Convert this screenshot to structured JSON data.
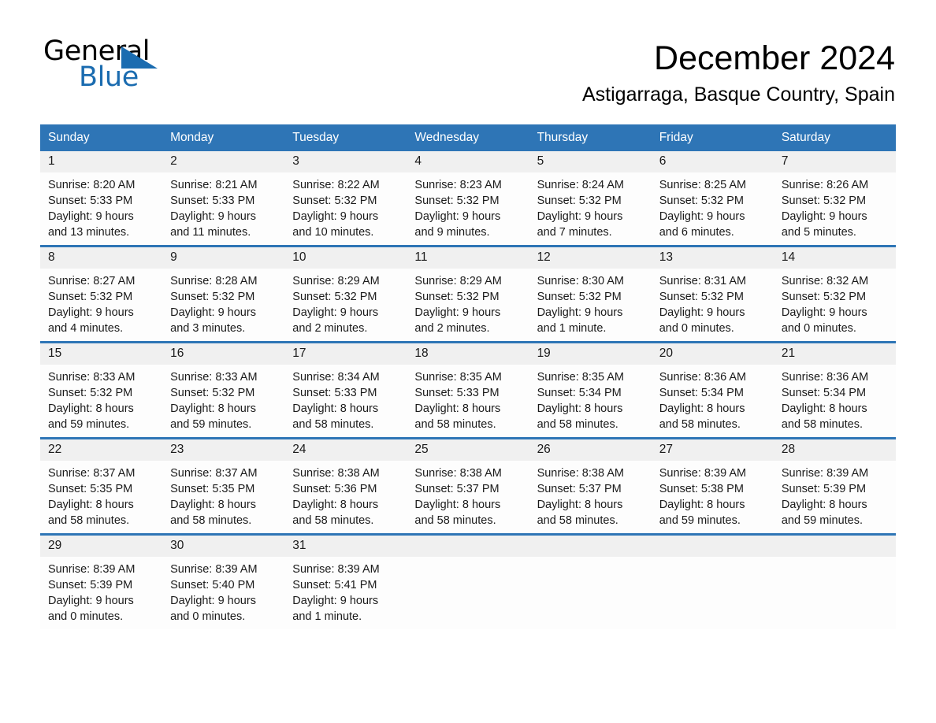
{
  "logo": {
    "word_one": "General",
    "word_two": "Blue",
    "accent_color": "#1b6cb0"
  },
  "header": {
    "month_title": "December 2024",
    "location": "Astigarraga, Basque Country, Spain"
  },
  "calendar": {
    "header_color": "#2e75b6",
    "daynum_band_color": "#f0f0f0",
    "weekday_headers": [
      "Sunday",
      "Monday",
      "Tuesday",
      "Wednesday",
      "Thursday",
      "Friday",
      "Saturday"
    ],
    "weeks": [
      [
        {
          "day": "1",
          "sunrise": "Sunrise: 8:20 AM",
          "sunset": "Sunset: 5:33 PM",
          "daylight_line1": "Daylight: 9 hours",
          "daylight_line2": "and 13 minutes."
        },
        {
          "day": "2",
          "sunrise": "Sunrise: 8:21 AM",
          "sunset": "Sunset: 5:33 PM",
          "daylight_line1": "Daylight: 9 hours",
          "daylight_line2": "and 11 minutes."
        },
        {
          "day": "3",
          "sunrise": "Sunrise: 8:22 AM",
          "sunset": "Sunset: 5:32 PM",
          "daylight_line1": "Daylight: 9 hours",
          "daylight_line2": "and 10 minutes."
        },
        {
          "day": "4",
          "sunrise": "Sunrise: 8:23 AM",
          "sunset": "Sunset: 5:32 PM",
          "daylight_line1": "Daylight: 9 hours",
          "daylight_line2": "and 9 minutes."
        },
        {
          "day": "5",
          "sunrise": "Sunrise: 8:24 AM",
          "sunset": "Sunset: 5:32 PM",
          "daylight_line1": "Daylight: 9 hours",
          "daylight_line2": "and 7 minutes."
        },
        {
          "day": "6",
          "sunrise": "Sunrise: 8:25 AM",
          "sunset": "Sunset: 5:32 PM",
          "daylight_line1": "Daylight: 9 hours",
          "daylight_line2": "and 6 minutes."
        },
        {
          "day": "7",
          "sunrise": "Sunrise: 8:26 AM",
          "sunset": "Sunset: 5:32 PM",
          "daylight_line1": "Daylight: 9 hours",
          "daylight_line2": "and 5 minutes."
        }
      ],
      [
        {
          "day": "8",
          "sunrise": "Sunrise: 8:27 AM",
          "sunset": "Sunset: 5:32 PM",
          "daylight_line1": "Daylight: 9 hours",
          "daylight_line2": "and 4 minutes."
        },
        {
          "day": "9",
          "sunrise": "Sunrise: 8:28 AM",
          "sunset": "Sunset: 5:32 PM",
          "daylight_line1": "Daylight: 9 hours",
          "daylight_line2": "and 3 minutes."
        },
        {
          "day": "10",
          "sunrise": "Sunrise: 8:29 AM",
          "sunset": "Sunset: 5:32 PM",
          "daylight_line1": "Daylight: 9 hours",
          "daylight_line2": "and 2 minutes."
        },
        {
          "day": "11",
          "sunrise": "Sunrise: 8:29 AM",
          "sunset": "Sunset: 5:32 PM",
          "daylight_line1": "Daylight: 9 hours",
          "daylight_line2": "and 2 minutes."
        },
        {
          "day": "12",
          "sunrise": "Sunrise: 8:30 AM",
          "sunset": "Sunset: 5:32 PM",
          "daylight_line1": "Daylight: 9 hours",
          "daylight_line2": "and 1 minute."
        },
        {
          "day": "13",
          "sunrise": "Sunrise: 8:31 AM",
          "sunset": "Sunset: 5:32 PM",
          "daylight_line1": "Daylight: 9 hours",
          "daylight_line2": "and 0 minutes."
        },
        {
          "day": "14",
          "sunrise": "Sunrise: 8:32 AM",
          "sunset": "Sunset: 5:32 PM",
          "daylight_line1": "Daylight: 9 hours",
          "daylight_line2": "and 0 minutes."
        }
      ],
      [
        {
          "day": "15",
          "sunrise": "Sunrise: 8:33 AM",
          "sunset": "Sunset: 5:32 PM",
          "daylight_line1": "Daylight: 8 hours",
          "daylight_line2": "and 59 minutes."
        },
        {
          "day": "16",
          "sunrise": "Sunrise: 8:33 AM",
          "sunset": "Sunset: 5:32 PM",
          "daylight_line1": "Daylight: 8 hours",
          "daylight_line2": "and 59 minutes."
        },
        {
          "day": "17",
          "sunrise": "Sunrise: 8:34 AM",
          "sunset": "Sunset: 5:33 PM",
          "daylight_line1": "Daylight: 8 hours",
          "daylight_line2": "and 58 minutes."
        },
        {
          "day": "18",
          "sunrise": "Sunrise: 8:35 AM",
          "sunset": "Sunset: 5:33 PM",
          "daylight_line1": "Daylight: 8 hours",
          "daylight_line2": "and 58 minutes."
        },
        {
          "day": "19",
          "sunrise": "Sunrise: 8:35 AM",
          "sunset": "Sunset: 5:34 PM",
          "daylight_line1": "Daylight: 8 hours",
          "daylight_line2": "and 58 minutes."
        },
        {
          "day": "20",
          "sunrise": "Sunrise: 8:36 AM",
          "sunset": "Sunset: 5:34 PM",
          "daylight_line1": "Daylight: 8 hours",
          "daylight_line2": "and 58 minutes."
        },
        {
          "day": "21",
          "sunrise": "Sunrise: 8:36 AM",
          "sunset": "Sunset: 5:34 PM",
          "daylight_line1": "Daylight: 8 hours",
          "daylight_line2": "and 58 minutes."
        }
      ],
      [
        {
          "day": "22",
          "sunrise": "Sunrise: 8:37 AM",
          "sunset": "Sunset: 5:35 PM",
          "daylight_line1": "Daylight: 8 hours",
          "daylight_line2": "and 58 minutes."
        },
        {
          "day": "23",
          "sunrise": "Sunrise: 8:37 AM",
          "sunset": "Sunset: 5:35 PM",
          "daylight_line1": "Daylight: 8 hours",
          "daylight_line2": "and 58 minutes."
        },
        {
          "day": "24",
          "sunrise": "Sunrise: 8:38 AM",
          "sunset": "Sunset: 5:36 PM",
          "daylight_line1": "Daylight: 8 hours",
          "daylight_line2": "and 58 minutes."
        },
        {
          "day": "25",
          "sunrise": "Sunrise: 8:38 AM",
          "sunset": "Sunset: 5:37 PM",
          "daylight_line1": "Daylight: 8 hours",
          "daylight_line2": "and 58 minutes."
        },
        {
          "day": "26",
          "sunrise": "Sunrise: 8:38 AM",
          "sunset": "Sunset: 5:37 PM",
          "daylight_line1": "Daylight: 8 hours",
          "daylight_line2": "and 58 minutes."
        },
        {
          "day": "27",
          "sunrise": "Sunrise: 8:39 AM",
          "sunset": "Sunset: 5:38 PM",
          "daylight_line1": "Daylight: 8 hours",
          "daylight_line2": "and 59 minutes."
        },
        {
          "day": "28",
          "sunrise": "Sunrise: 8:39 AM",
          "sunset": "Sunset: 5:39 PM",
          "daylight_line1": "Daylight: 8 hours",
          "daylight_line2": "and 59 minutes."
        }
      ],
      [
        {
          "day": "29",
          "sunrise": "Sunrise: 8:39 AM",
          "sunset": "Sunset: 5:39 PM",
          "daylight_line1": "Daylight: 9 hours",
          "daylight_line2": "and 0 minutes."
        },
        {
          "day": "30",
          "sunrise": "Sunrise: 8:39 AM",
          "sunset": "Sunset: 5:40 PM",
          "daylight_line1": "Daylight: 9 hours",
          "daylight_line2": "and 0 minutes."
        },
        {
          "day": "31",
          "sunrise": "Sunrise: 8:39 AM",
          "sunset": "Sunset: 5:41 PM",
          "daylight_line1": "Daylight: 9 hours",
          "daylight_line2": "and 1 minute."
        },
        {
          "day": "",
          "sunrise": "",
          "sunset": "",
          "daylight_line1": "",
          "daylight_line2": ""
        },
        {
          "day": "",
          "sunrise": "",
          "sunset": "",
          "daylight_line1": "",
          "daylight_line2": ""
        },
        {
          "day": "",
          "sunrise": "",
          "sunset": "",
          "daylight_line1": "",
          "daylight_line2": ""
        },
        {
          "day": "",
          "sunrise": "",
          "sunset": "",
          "daylight_line1": "",
          "daylight_line2": ""
        }
      ]
    ]
  }
}
